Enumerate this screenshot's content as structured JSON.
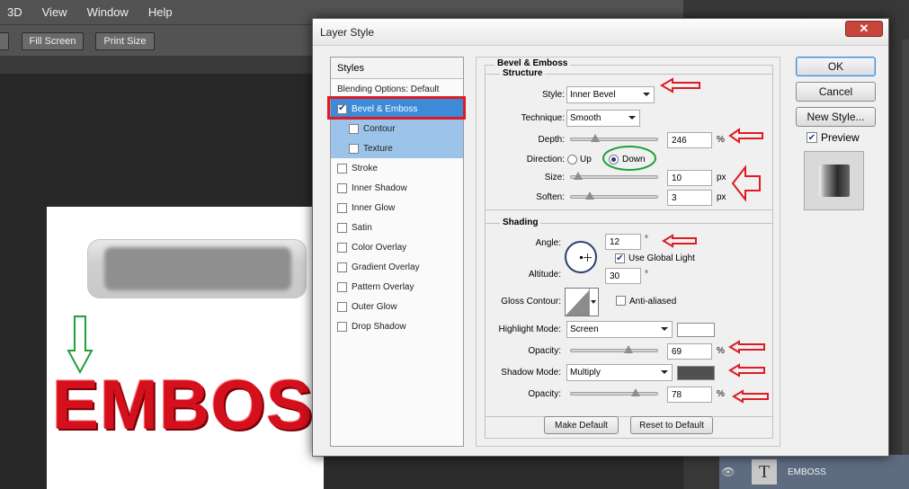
{
  "menu": [
    "3D",
    "View",
    "Window",
    "Help"
  ],
  "window_controls": {
    "minimize": "−",
    "restore": "❐",
    "close": "✕"
  },
  "options_bar": {
    "fill_screen": "Fill Screen",
    "print_size": "Print Size"
  },
  "canvas_text": "EMBOSS",
  "layers_panel": {
    "layer_name": "EMBOSS",
    "type_glyph": "T",
    "eye": "👁"
  },
  "dialog": {
    "title": "Layer Style",
    "close_glyph": "✕",
    "styles_header": "Styles",
    "styles": [
      {
        "label": "Blending Options: Default",
        "checkbox": false,
        "checked": false,
        "selected": false,
        "sub": false
      },
      {
        "label": "Bevel & Emboss",
        "checkbox": true,
        "checked": true,
        "selected": true,
        "sub": false
      },
      {
        "label": "Contour",
        "checkbox": true,
        "checked": false,
        "selected": false,
        "sub": true
      },
      {
        "label": "Texture",
        "checkbox": true,
        "checked": false,
        "selected": false,
        "sub": true
      },
      {
        "label": "Stroke",
        "checkbox": true,
        "checked": false,
        "selected": false,
        "sub": false
      },
      {
        "label": "Inner Shadow",
        "checkbox": true,
        "checked": false,
        "selected": false,
        "sub": false
      },
      {
        "label": "Inner Glow",
        "checkbox": true,
        "checked": false,
        "selected": false,
        "sub": false
      },
      {
        "label": "Satin",
        "checkbox": true,
        "checked": false,
        "selected": false,
        "sub": false
      },
      {
        "label": "Color Overlay",
        "checkbox": true,
        "checked": false,
        "selected": false,
        "sub": false
      },
      {
        "label": "Gradient Overlay",
        "checkbox": true,
        "checked": false,
        "selected": false,
        "sub": false
      },
      {
        "label": "Pattern Overlay",
        "checkbox": true,
        "checked": false,
        "selected": false,
        "sub": false
      },
      {
        "label": "Outer Glow",
        "checkbox": true,
        "checked": false,
        "selected": false,
        "sub": false
      },
      {
        "label": "Drop Shadow",
        "checkbox": true,
        "checked": false,
        "selected": false,
        "sub": false
      }
    ],
    "section_title": "Bevel & Emboss",
    "structure": {
      "title": "Structure",
      "style_label": "Style:",
      "style_value": "Inner Bevel",
      "technique_label": "Technique:",
      "technique_value": "Smooth",
      "depth_label": "Depth:",
      "depth_value": "246",
      "depth_unit": "%",
      "depth_level": 0.25,
      "direction_label": "Direction:",
      "direction_up": "Up",
      "direction_down": "Down",
      "direction_selected": "Down",
      "size_label": "Size:",
      "size_value": "10",
      "size_unit": "px",
      "size_level": 0.04,
      "soften_label": "Soften:",
      "soften_value": "3",
      "soften_unit": "px",
      "soften_level": 0.19
    },
    "shading": {
      "title": "Shading",
      "angle_label": "Angle:",
      "angle_value": "12",
      "degree": "°",
      "use_global_light": "Use Global Light",
      "use_global_light_checked": true,
      "altitude_label": "Altitude:",
      "altitude_value": "30",
      "gloss_contour_label": "Gloss Contour:",
      "anti_aliased": "Anti-aliased",
      "anti_aliased_checked": false,
      "highlight_mode_label": "Highlight Mode:",
      "highlight_mode_value": "Screen",
      "highlight_color": "#ffffff",
      "highlight_opacity_label": "Opacity:",
      "highlight_opacity_value": "69",
      "highlight_opacity_unit": "%",
      "highlight_opacity_level": 0.69,
      "shadow_mode_label": "Shadow Mode:",
      "shadow_mode_value": "Multiply",
      "shadow_color": "#505050",
      "shadow_opacity_label": "Opacity:",
      "shadow_opacity_value": "78",
      "shadow_opacity_unit": "%",
      "shadow_opacity_level": 0.78
    },
    "make_default": "Make Default",
    "reset_to_default": "Reset to Default",
    "ok": "OK",
    "cancel": "Cancel",
    "new_style": "New Style...",
    "preview_label": "Preview",
    "preview_checked": true
  },
  "colors": {
    "selected_row": "#3c8bd8",
    "sub_row": "#9cc4ea",
    "annotation_red": "#e01a22",
    "annotation_green": "#1fa13a",
    "emboss_red": "#d4101c"
  }
}
